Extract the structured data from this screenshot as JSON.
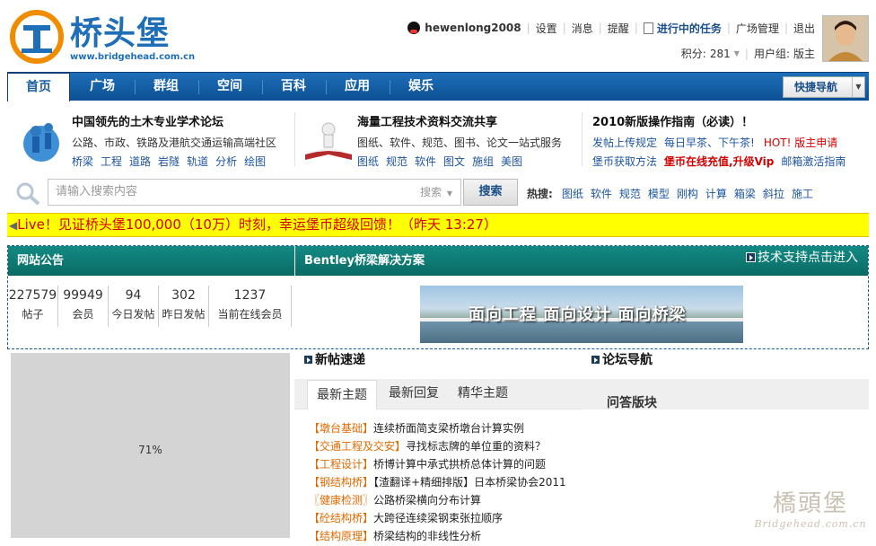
{
  "brand": {
    "name": "桥头堡",
    "url": "www.bridgehead.com.cn"
  },
  "user": {
    "name": "hewenlong2008",
    "links": [
      "设置",
      "消息",
      "提醒"
    ],
    "tasks": "进行中的任务",
    "links2": [
      "广场管理",
      "退出"
    ],
    "points_label": "积分:",
    "points": "281",
    "group_label": "用户组:",
    "group": "版主"
  },
  "nav": {
    "items": [
      "首页",
      "广场",
      "群组",
      "空间",
      "百科",
      "应用",
      "娱乐"
    ],
    "active": "首页",
    "quick": "快捷导航"
  },
  "promo": [
    {
      "title": "中国领先的土木专业学术论坛",
      "desc": "公路、市政、铁路及港航交通运输高端社区",
      "links": [
        "桥梁",
        "工程",
        "道路",
        "岩隧",
        "轨道",
        "分析",
        "绘图"
      ]
    },
    {
      "title": "海量工程技术资料交流共享",
      "desc": "图纸、软件、规范、图书、论文一站式服务",
      "links": [
        "图纸",
        "规范",
        "软件",
        "图文",
        "施组",
        "美图"
      ]
    },
    {
      "title": "2010新版操作指南（必读）！",
      "row1": [
        "发帖上传规定",
        "每日早茶、下午茶!",
        "HOT! 版主申请"
      ],
      "row2": [
        "堡币获取方法",
        "堡币在线充值,升级Vip",
        "邮箱激活指南"
      ]
    }
  ],
  "search": {
    "placeholder": "请输入搜索内容",
    "type": "搜索",
    "button": "搜索",
    "hot_label": "热搜:",
    "hot": [
      "图纸",
      "软件",
      "规范",
      "模型",
      "刚构",
      "计算",
      "箱梁",
      "斜拉",
      "施工"
    ]
  },
  "live": "Live！见证桥头堡100,000（10万）时刻，幸运堡币超级回馈！（昨天 13:27）",
  "announce": {
    "title": "网站公告",
    "bentley": "Bentley桥梁解决方案",
    "tech": "技术支持点击进入"
  },
  "stats": [
    {
      "value": "227579",
      "label": "帖子"
    },
    {
      "value": "99949",
      "label": "会员"
    },
    {
      "value": "94",
      "label": "今日发帖"
    },
    {
      "value": "302",
      "label": "昨日发帖"
    },
    {
      "value": "1237",
      "label": "当前在线会员"
    }
  ],
  "banner_text": "面向工程 面向设计 面向桥梁",
  "grey_text": "71%",
  "sections": {
    "new": "新帖速递",
    "forum_nav": "论坛导航",
    "qa": "问答版块"
  },
  "tabs": [
    "最新主题",
    "最新回复",
    "精华主题"
  ],
  "threads": [
    {
      "cat": "【墩台基础】",
      "title": "连续桥面简支梁桥墩台计算实例"
    },
    {
      "cat": "【交通工程及交安】",
      "title": "寻找标志牌的单位重的资料？"
    },
    {
      "cat": "【工程设计】",
      "title": "桥博计算中承式拱桥总体计算的问题"
    },
    {
      "cat": "【钢结构桥】",
      "title": "【渣翻译+精细排版】日本桥梁协会2011"
    },
    {
      "cat": "〖健康检测〗",
      "title": "公路桥梁横向分布计算"
    },
    {
      "cat": "【砼结构桥】",
      "title": "大跨径连续梁钢束张拉顺序"
    },
    {
      "cat": "【结构原理】",
      "title": "桥梁结构的非线性分析"
    }
  ],
  "watermark": {
    "main": "橋頭堡",
    "sub": "Bridgehead.com.cn"
  },
  "colors": {
    "nav": "#0c4f93",
    "teal": "#0b6a64",
    "live_bg": "#ffff00",
    "live_text": "#d40000",
    "cat": "#e06a00"
  }
}
